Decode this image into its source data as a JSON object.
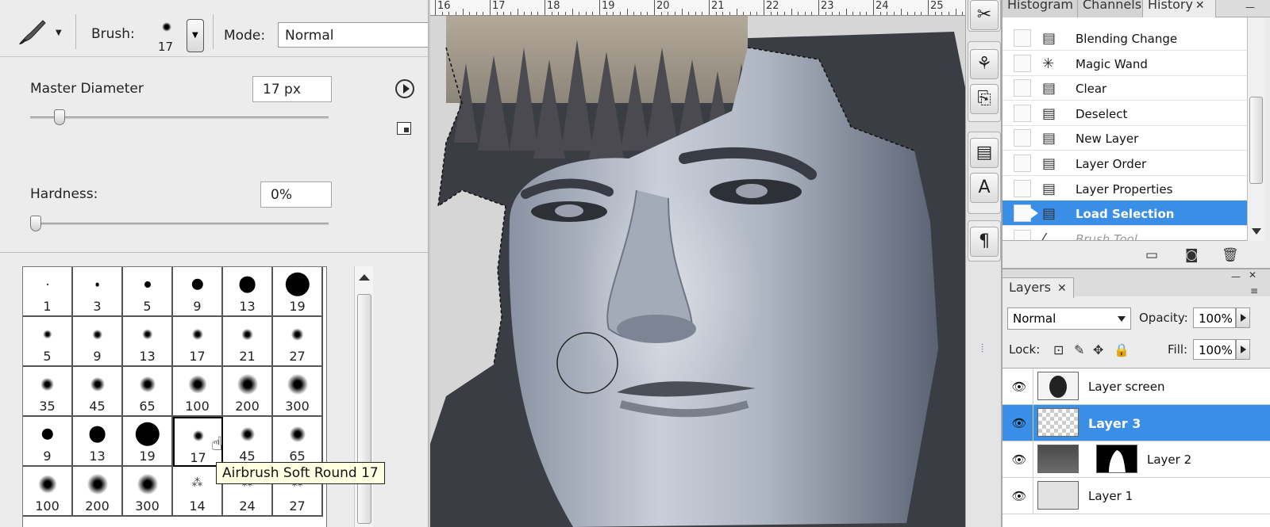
{
  "options_bar": {
    "brush_label": "Brush:",
    "brush_size": "17",
    "mode_label": "Mode:",
    "mode_value": "Normal"
  },
  "brush_picker": {
    "master_diameter_label": "Master Diameter",
    "master_diameter_value": "17 px",
    "master_diameter_level": 0.08,
    "hardness_label": "Hardness:",
    "hardness_value": "0%",
    "hardness_level": 0.0,
    "tooltip": "Airbrush Soft Round 17",
    "presets": [
      {
        "size": "1",
        "kind": "hard"
      },
      {
        "size": "3",
        "kind": "hard"
      },
      {
        "size": "5",
        "kind": "hard"
      },
      {
        "size": "9",
        "kind": "hard"
      },
      {
        "size": "13",
        "kind": "hard"
      },
      {
        "size": "19",
        "kind": "hard"
      },
      {
        "size": "5",
        "kind": "soft"
      },
      {
        "size": "9",
        "kind": "soft"
      },
      {
        "size": "13",
        "kind": "soft"
      },
      {
        "size": "17",
        "kind": "soft"
      },
      {
        "size": "21",
        "kind": "soft"
      },
      {
        "size": "27",
        "kind": "soft"
      },
      {
        "size": "35",
        "kind": "soft"
      },
      {
        "size": "45",
        "kind": "soft"
      },
      {
        "size": "65",
        "kind": "soft"
      },
      {
        "size": "100",
        "kind": "soft"
      },
      {
        "size": "200",
        "kind": "soft"
      },
      {
        "size": "300",
        "kind": "soft"
      },
      {
        "size": "9",
        "kind": "hard"
      },
      {
        "size": "13",
        "kind": "hard"
      },
      {
        "size": "19",
        "kind": "hard"
      },
      {
        "size": "17",
        "kind": "soft",
        "selected": true
      },
      {
        "size": "45",
        "kind": "soft"
      },
      {
        "size": "65",
        "kind": "soft"
      },
      {
        "size": "100",
        "kind": "soft"
      },
      {
        "size": "200",
        "kind": "soft"
      },
      {
        "size": "300",
        "kind": "soft"
      },
      {
        "size": "14",
        "kind": "texture"
      },
      {
        "size": "24",
        "kind": "texture"
      },
      {
        "size": "27",
        "kind": "texture"
      }
    ]
  },
  "ruler": {
    "labels": [
      "16",
      "17",
      "18",
      "19",
      "20",
      "21",
      "22",
      "23",
      "24",
      "25"
    ]
  },
  "history_panel": {
    "tabs": [
      "Histogram",
      "Channels",
      "History"
    ],
    "active_tab": "History",
    "close_glyph": "✕",
    "items": [
      {
        "label": "Blending Change"
      },
      {
        "label": "Magic Wand"
      },
      {
        "label": "Clear"
      },
      {
        "label": "Deselect"
      },
      {
        "label": "New Layer"
      },
      {
        "label": "Layer Order"
      },
      {
        "label": "Layer Properties"
      },
      {
        "label": "Load Selection",
        "active": true
      },
      {
        "label": "Brush Tool",
        "dim": true
      }
    ]
  },
  "layers_panel": {
    "tab_label": "Layers",
    "close_glyph": "✕",
    "blend_mode": "Normal",
    "opacity_label": "Opacity:",
    "opacity_value": "100%",
    "lock_label": "Lock:",
    "fill_label": "Fill:",
    "fill_value": "100%",
    "layers": [
      {
        "name": "Layer screen",
        "visible": true
      },
      {
        "name": "Layer 3",
        "visible": true,
        "active": true
      },
      {
        "name": "Layer 2",
        "visible": true,
        "has_mask": true
      },
      {
        "name": "Layer 1",
        "visible": true
      }
    ]
  },
  "colors": {
    "selection_blue": "#3a8ee6",
    "tooltip_bg": "#ffffe1",
    "panel_bg": "#ececec"
  }
}
